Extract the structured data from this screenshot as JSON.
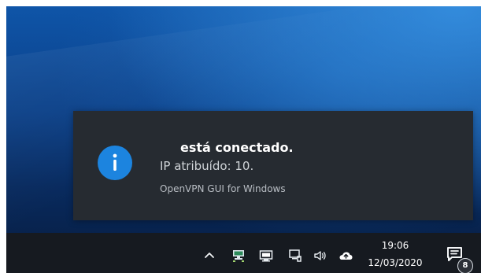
{
  "notification": {
    "title": "está conectado.",
    "message": "IP atribuído: 10.",
    "source": "OpenVPN GUI for Windows",
    "icon": "info-icon",
    "accent": "#1c84df"
  },
  "tray": {
    "icons": [
      "chevron-up-icon",
      "network-activity-icon",
      "openvpn-icon",
      "network-icon",
      "volume-icon",
      "cloud-upload-icon"
    ]
  },
  "clock": {
    "time": "19:06",
    "date": "12/03/2020"
  },
  "action_center": {
    "icon": "notifications-icon",
    "badge": "8"
  },
  "colors": {
    "taskbar": "#161a20",
    "toast_background": "#262b31",
    "desktop_blue": "#0f55a8"
  }
}
